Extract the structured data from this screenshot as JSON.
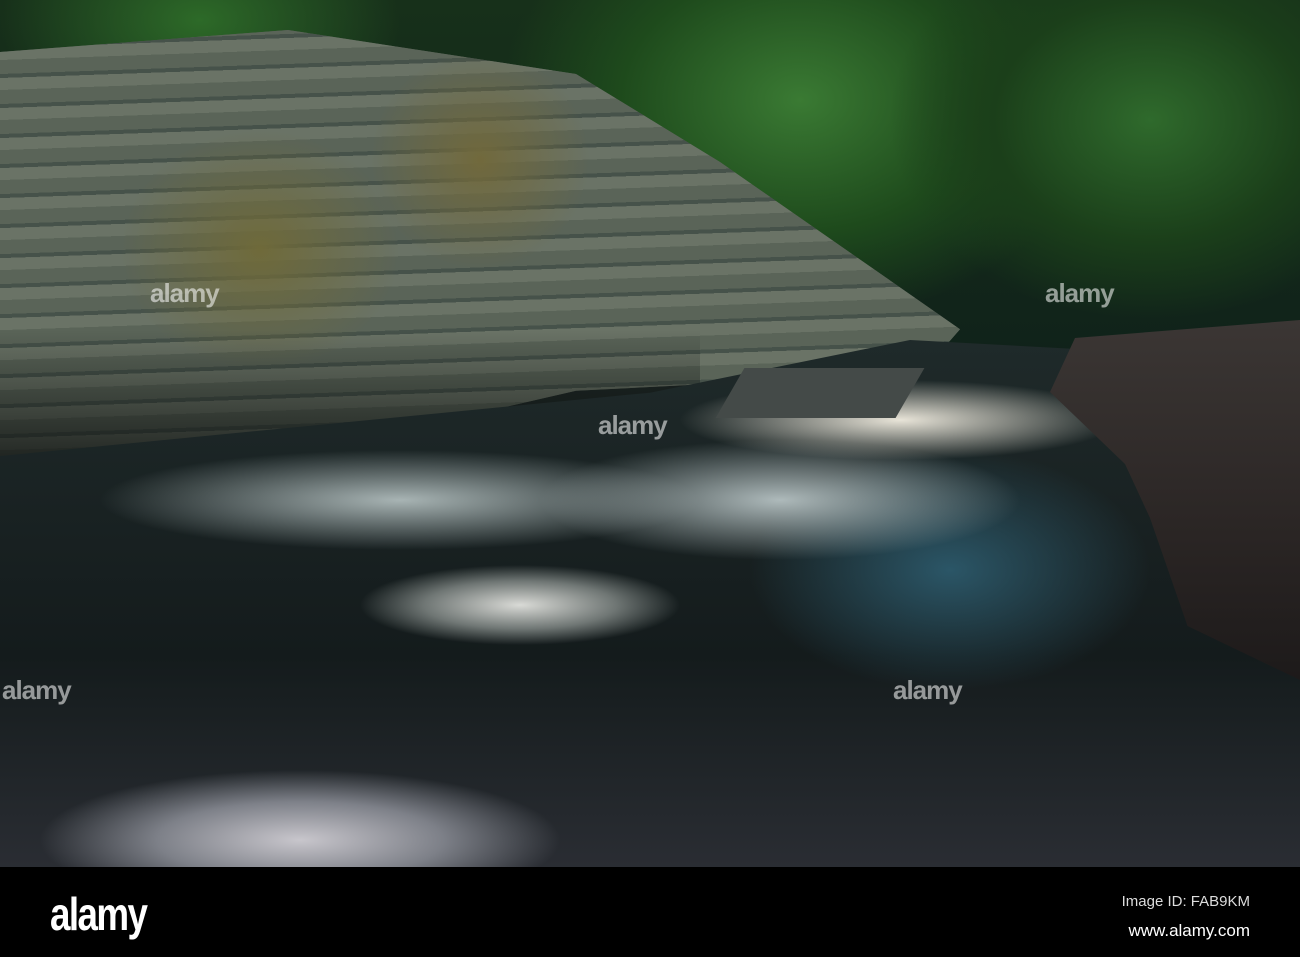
{
  "photo": {
    "subject": "River rapids flowing through a forested rocky gorge"
  },
  "watermark": {
    "text": "alamy"
  },
  "footer": {
    "logo": "alamy",
    "image_id": "Image ID: FAB9KM",
    "website": "www.alamy.com"
  }
}
